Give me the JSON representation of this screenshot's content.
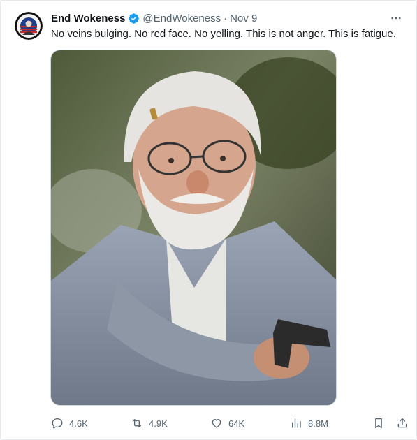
{
  "tweet": {
    "author_name": "End Wokeness",
    "author_handle": "@EndWokeness",
    "separator": "·",
    "date": "Nov 9",
    "text": "No veins bulging. No red face. No yelling. This is not anger. This is fatigue.",
    "avatar_text": "EVERYTHING WOKE TURNS TO"
  },
  "metrics": {
    "replies": "4.6K",
    "retweets": "4.9K",
    "likes": "64K",
    "views": "8.8M"
  },
  "colors": {
    "verified_badge": "#1d9bf0",
    "secondary_text": "#536471",
    "primary_text": "#0f1419"
  },
  "icons": {
    "verified": "verified-badge-icon",
    "more": "more-dots-icon",
    "reply": "reply-icon",
    "retweet": "retweet-icon",
    "like": "heart-icon",
    "views": "views-icon",
    "bookmark": "bookmark-icon",
    "share": "share-icon"
  }
}
